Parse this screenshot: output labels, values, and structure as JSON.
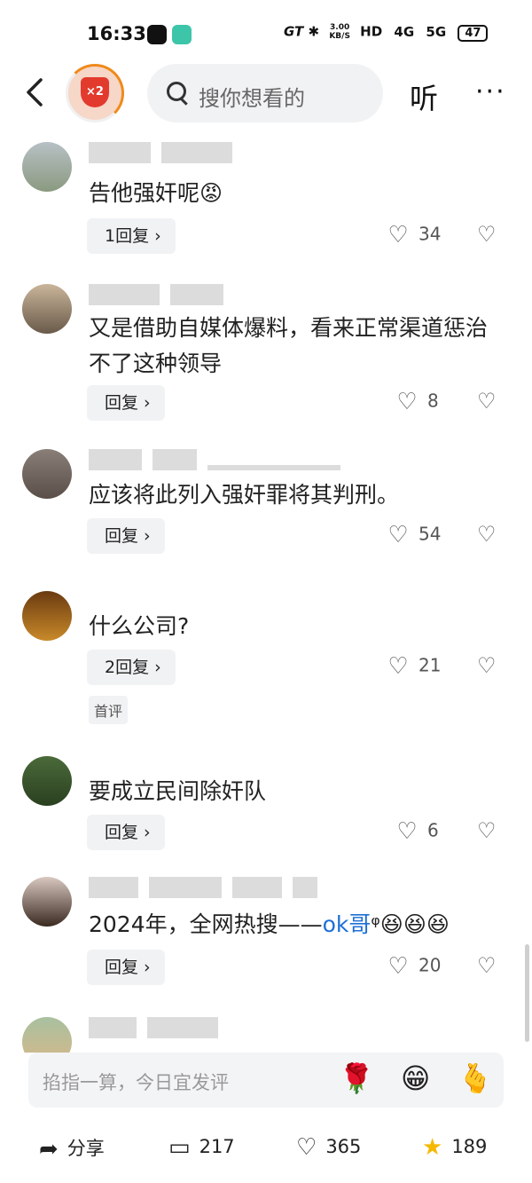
{
  "status_bar": {
    "time": "16:33",
    "speed_top": "3.00",
    "speed_bottom": "KB/S",
    "hd": "HD",
    "net1": "4G",
    "net2": "5G",
    "battery": "47",
    "gt": "GT"
  },
  "header": {
    "badge_text": "×2",
    "search_placeholder": "搜你想看的",
    "listen_label": "听",
    "more_label": "···"
  },
  "comments": [
    {
      "text": "告他强奸呢😡",
      "reply": "1回复 ›",
      "likes": "34"
    },
    {
      "text": "又是借助自媒体爆料，看来正常渠道惩治不了这种领导",
      "reply": "回复 ›",
      "likes": "8"
    },
    {
      "text": "应该将此列入强奸罪将其判刑。",
      "reply": "回复 ›",
      "likes": "54"
    },
    {
      "text": "什么公司?",
      "reply": "2回复 ›",
      "likes": "21",
      "tag": "首评"
    },
    {
      "text": "要成立民间除奸队",
      "reply": "回复 ›",
      "likes": "6"
    },
    {
      "text_prefix": "2024年，全网热搜——",
      "text_link": "ok哥",
      "text_suffix": "ᵠ😆😆😆",
      "reply": "回复 ›",
      "likes": "20"
    }
  ],
  "input_bar": {
    "placeholder": "掐指一算，今日宜发评",
    "emoji1": "🌹",
    "emoji2": "😁",
    "emoji3": "🫰"
  },
  "bottom_bar": {
    "share_label": "分享",
    "comment_count": "217",
    "like_count": "365",
    "fav_count": "189"
  }
}
